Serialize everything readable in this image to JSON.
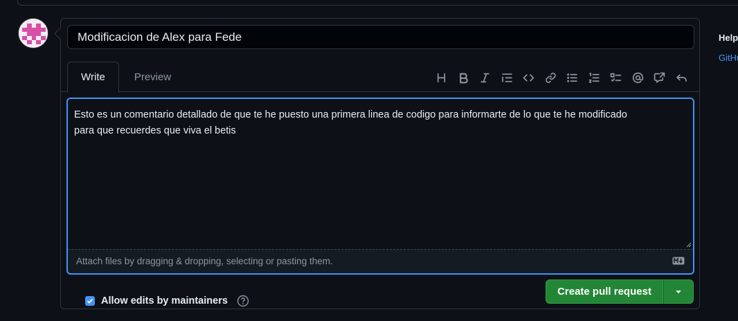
{
  "form": {
    "title_value": "Modificacion de Alex para Fede",
    "tabs": [
      {
        "label": "Write",
        "active": true
      },
      {
        "label": "Preview",
        "active": false
      }
    ],
    "toolbar_icons": [
      "heading-icon",
      "bold-icon",
      "italic-icon",
      "quote-icon",
      "code-icon",
      "link-icon",
      "unordered-list-icon",
      "ordered-list-icon",
      "task-list-icon",
      "mention-icon",
      "cross-reference-icon",
      "undo-icon"
    ],
    "body_text": "Esto es un comentario detallado de que te he puesto una primera linea de codigo para informarte de lo que te he modificado\npara que recuerdes que viva el betis",
    "attach_hint": "Attach files by dragging & dropping, selecting or pasting them.",
    "allow_edits_label": "Allow edits by maintainers",
    "allow_edits_checked": true,
    "create_button_label": "Create pull request"
  },
  "sidebar": {
    "help_label": "Help",
    "link_label": "GitHu"
  },
  "colors": {
    "background": "#0d1117",
    "accent_blue": "#4493f8",
    "button_green": "#238636",
    "border": "#30363d",
    "muted_text": "#8d96a0"
  }
}
